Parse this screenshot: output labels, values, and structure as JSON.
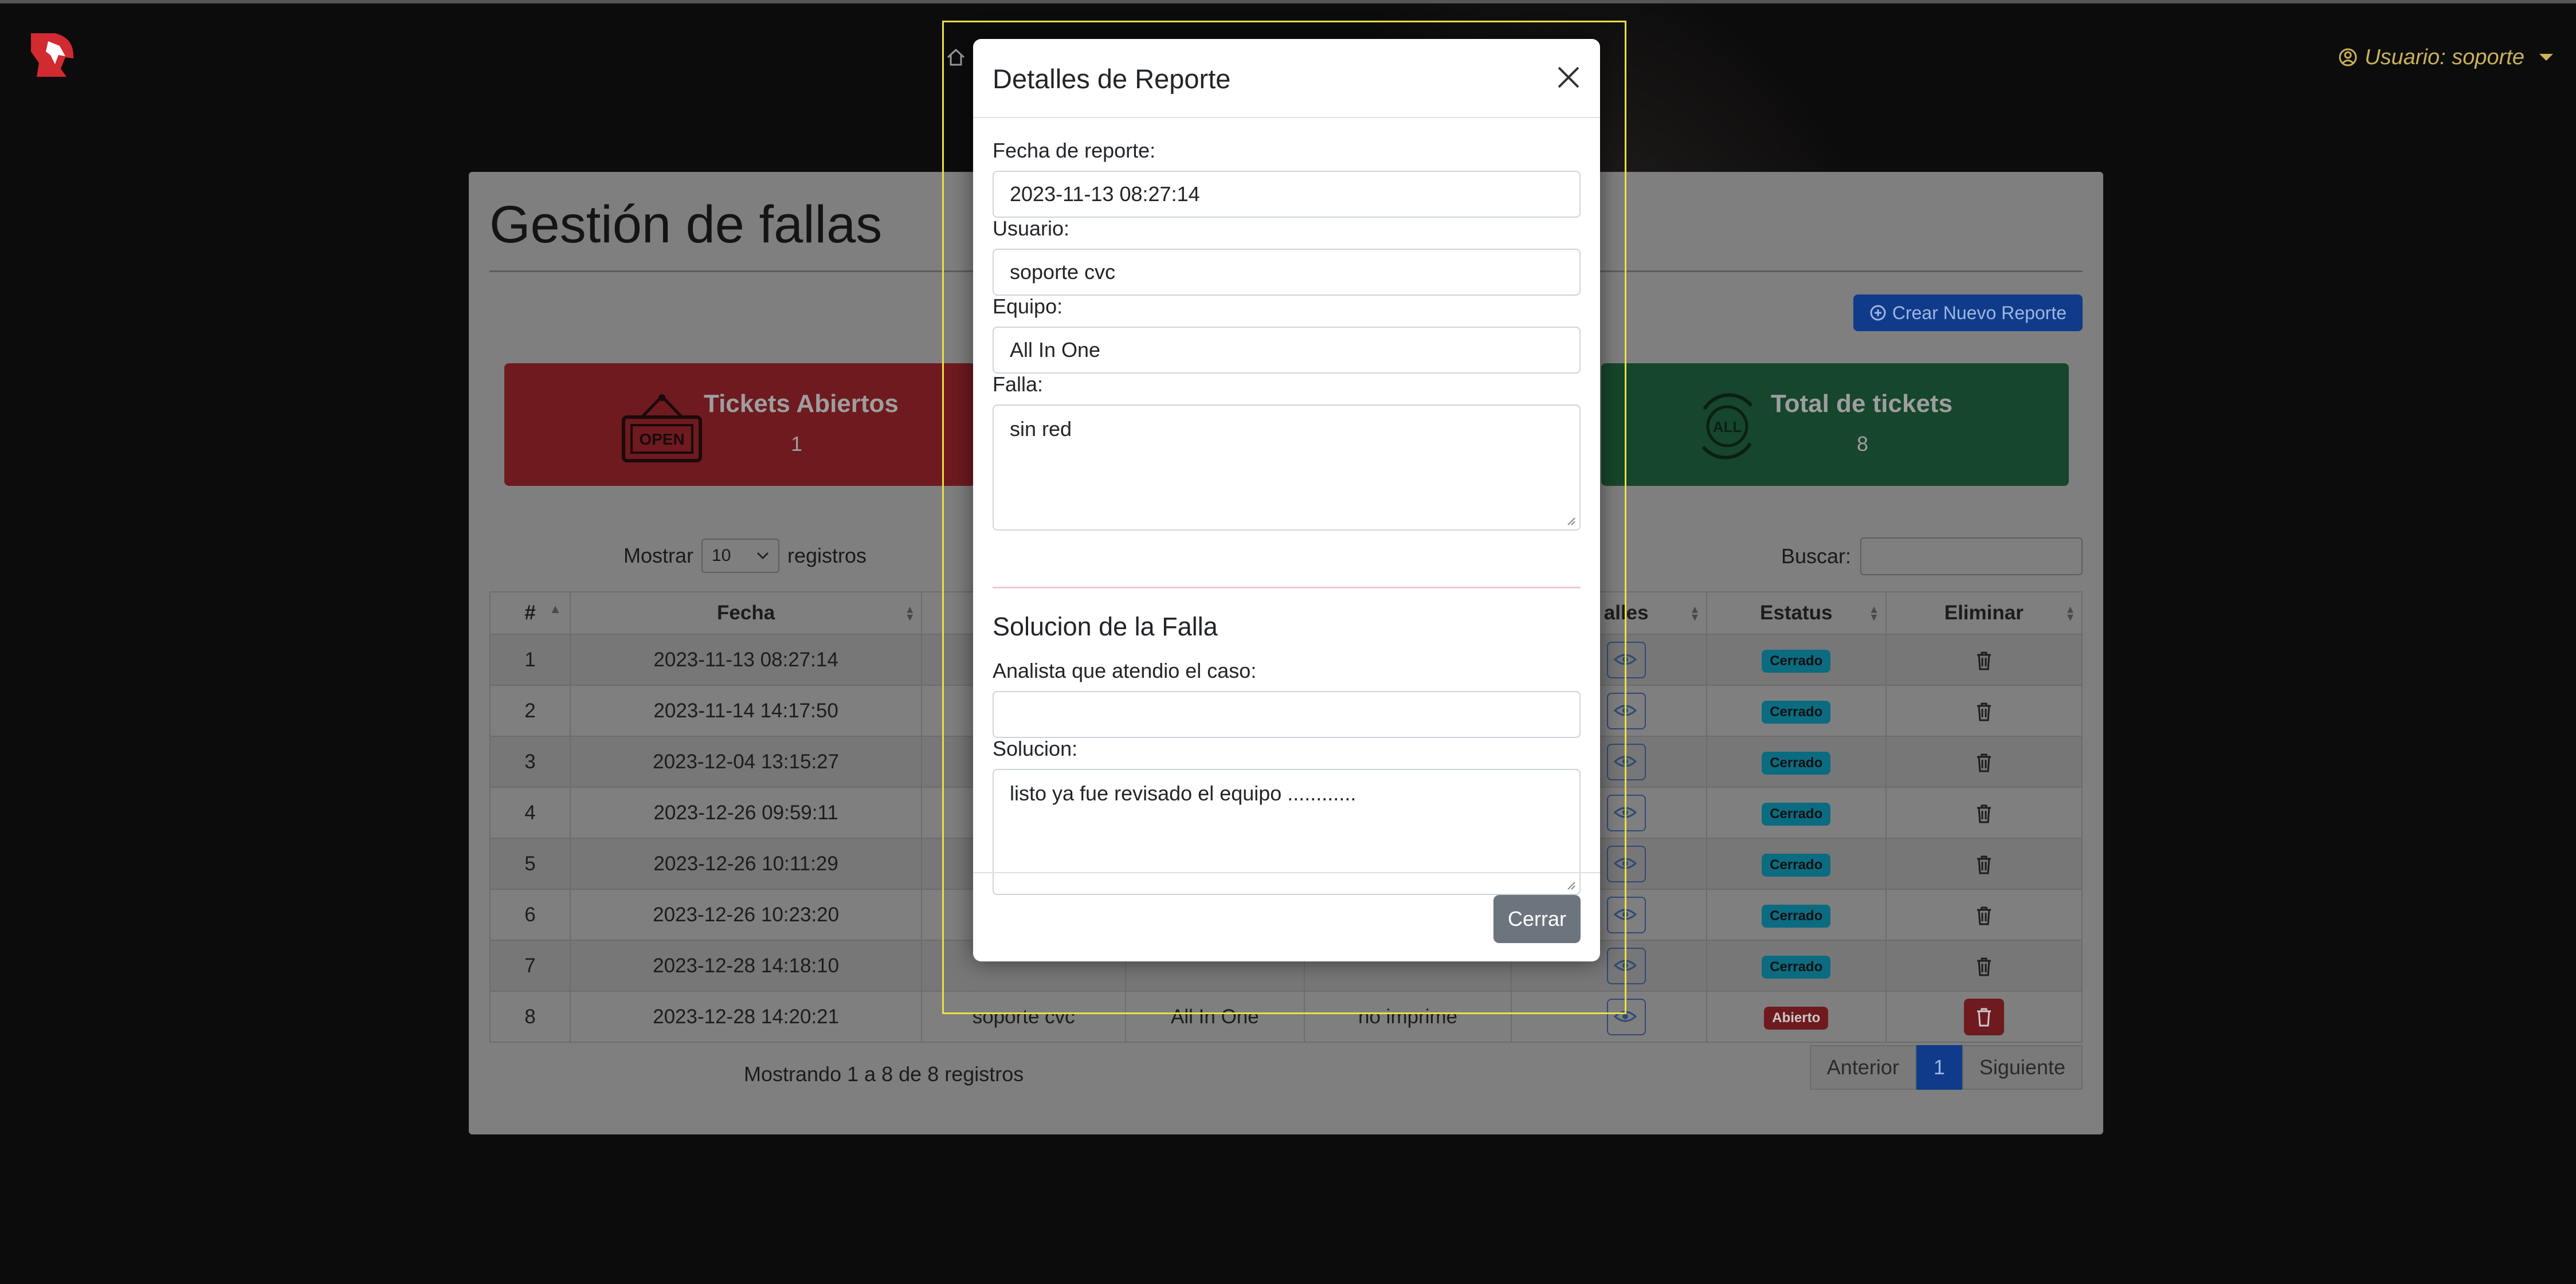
{
  "user_menu": {
    "label": "Usuario: soporte"
  },
  "page": {
    "title": "Gestión de fallas",
    "create_button": "Crear Nuevo Reporte"
  },
  "cards": {
    "open": {
      "label": "Tickets Abiertos",
      "count": "1",
      "sign_text": "OPEN"
    },
    "total": {
      "label": "Total de tickets",
      "count": "8",
      "icon_text": "ALL"
    }
  },
  "table_controls": {
    "show_label": "Mostrar",
    "length_value": "10",
    "records_label": "registros",
    "search_label": "Buscar:"
  },
  "table": {
    "headers": [
      "#",
      "Fecha",
      "",
      "",
      "",
      "alles",
      "Estatus",
      "Eliminar"
    ],
    "rows": [
      {
        "num": "1",
        "date": "2023-11-13 08:27:14",
        "user": "",
        "equipo": "",
        "falla": "",
        "status": "Cerrado"
      },
      {
        "num": "2",
        "date": "2023-11-14 14:17:50",
        "user": "",
        "equipo": "",
        "falla": "",
        "status": "Cerrado"
      },
      {
        "num": "3",
        "date": "2023-12-04 13:15:27",
        "user": "",
        "equipo": "",
        "falla": "",
        "status": "Cerrado"
      },
      {
        "num": "4",
        "date": "2023-12-26 09:59:11",
        "user": "",
        "equipo": "",
        "falla": "",
        "status": "Cerrado"
      },
      {
        "num": "5",
        "date": "2023-12-26 10:11:29",
        "user": "",
        "equipo": "",
        "falla": "",
        "status": "Cerrado"
      },
      {
        "num": "6",
        "date": "2023-12-26 10:23:20",
        "user": "",
        "equipo": "",
        "falla": "",
        "status": "Cerrado"
      },
      {
        "num": "7",
        "date": "2023-12-28 14:18:10",
        "user": "",
        "equipo": "",
        "falla": "",
        "status": "Cerrado"
      },
      {
        "num": "8",
        "date": "2023-12-28 14:20:21",
        "user": "soporte cvc",
        "equipo": "All In One",
        "falla": "no imprime",
        "status": "Abierto"
      }
    ]
  },
  "table_info": "Mostrando 1 a 8 de 8 registros",
  "pagination": {
    "prev": "Anterior",
    "current": "1",
    "next": "Siguiente"
  },
  "modal": {
    "title": "Detalles de Reporte",
    "fecha_label": "Fecha de reporte:",
    "fecha_value": "2023-11-13 08:27:14",
    "usuario_label": "Usuario:",
    "usuario_value": "soporte cvc",
    "equipo_label": "Equipo:",
    "equipo_value": "All In One",
    "falla_label": "Falla:",
    "falla_value": "sin red",
    "solution_title": "Solucion de la Falla",
    "analista_label": "Analista que atendio el caso:",
    "analista_value": "",
    "solucion_label": "Solucion:",
    "solucion_value": "listo ya fue revisado el equipo ............",
    "close_button": "Cerrar"
  },
  "colors": {
    "highlight": "#e8e046",
    "primary": "#0d6efd",
    "closed_badge": "#0dcaf0",
    "open_badge": "#dc3545",
    "secondary_button": "#6c757d"
  }
}
